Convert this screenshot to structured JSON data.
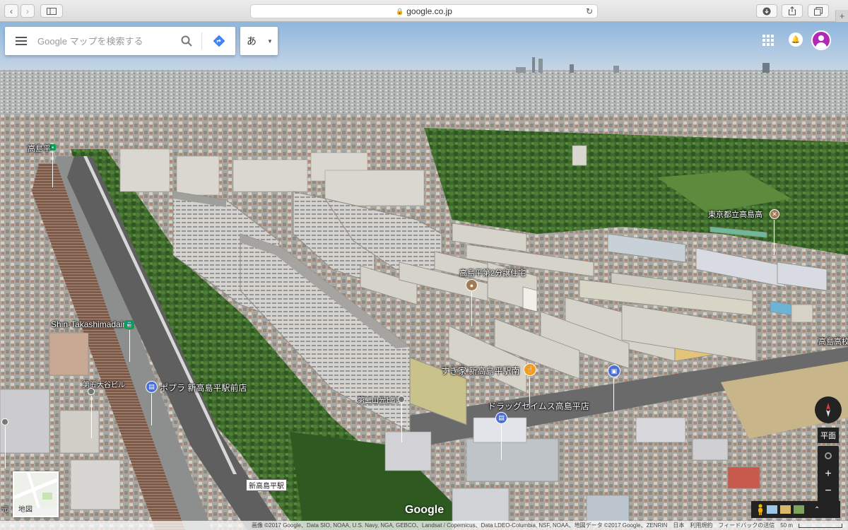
{
  "browser": {
    "url": "google.co.jp",
    "back_label": "‹",
    "forward_label": "›",
    "new_tab_label": "+"
  },
  "search": {
    "placeholder": "Google マップを検索する",
    "ime_label": "あ"
  },
  "places": {
    "takashimadaira_station": "高島平",
    "shin_takashimadaira": "Shin-Takashimadaira",
    "danchi": "高島平第2分譲住宅",
    "school": "東京都立高島高",
    "school2": "高島高校前",
    "sukiya": "すき家 新高島平駅南",
    "drugstore": "ドラッグセイムス高島平店",
    "poplar": "ポプラ 新高島平駅前店",
    "building1": "第五大谷ビル",
    "building2": "第二山光ビル",
    "road_sign": "新高島平駅",
    "left_edge": "元"
  },
  "controls": {
    "tilt_label": "平面",
    "zoom_in": "+",
    "zoom_out": "−",
    "layer_label": "地図"
  },
  "logo": "Google",
  "attribution": {
    "imagery": "画像 ©2017 Google、Data SIO, NOAA, U.S. Navy, NGA, GEBCO、Landsat / Copernicus、Data LDEO-Columbia, NSF, NOAA、地図データ ©2017 Google、ZENRIN",
    "country": "日本",
    "terms": "利用規約",
    "feedback": "フィードバックの送信",
    "scale": "50 m"
  },
  "colors": {
    "sky": "#9ec3e3",
    "foliage": "#3f6a2e",
    "building_wall": "#c9c7c0",
    "station_green": "#0f9d58",
    "poi_blue": "#4a6fd8",
    "poi_orange": "#f29c1f",
    "pin_brown": "#a07b55"
  }
}
